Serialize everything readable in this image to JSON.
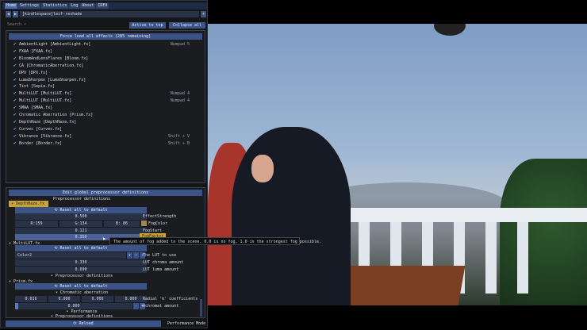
{
  "menu": [
    "Home",
    "Settings",
    "Statistics",
    "Log",
    "About",
    "IDE9"
  ],
  "preset": "[kindlespace]leif-reshade",
  "search": {
    "placeholder": "Search",
    "icon": "search-icon"
  },
  "buttons": {
    "active_to_top": "Active to top",
    "collapse_all": "Collapse all",
    "force_load": "Force load all effects (285 remaining)",
    "edit_global": "Edit global preprocessor definitions",
    "reload": "Reload",
    "performance_mode": "Performance Mode"
  },
  "effects": [
    {
      "name": "AmbientLight [AmbientLight.fx]",
      "key": "Numpad 5"
    },
    {
      "name": "FXAA [FXAA.fx]",
      "key": ""
    },
    {
      "name": "BloomAndLensFlares [Bloom.fx]",
      "key": ""
    },
    {
      "name": "CA [ChromaticAberration.fx]",
      "key": ""
    },
    {
      "name": "DPX [DPX.fx]",
      "key": ""
    },
    {
      "name": "LumaSharpen [LumaSharpen.fx]",
      "key": ""
    },
    {
      "name": "Tint [Sepia.fx]",
      "key": ""
    },
    {
      "name": "MultiLUT [MultiLUT.fx]",
      "key": "Numpad 4"
    },
    {
      "name": "MultiLUT [MultiLUT.fx]",
      "key": "Numpad 4"
    },
    {
      "name": "SMAA [SMAA.fx]",
      "key": ""
    },
    {
      "name": "Chromatic Aberration [Prism.fx]",
      "key": ""
    },
    {
      "name": "DepthHaze [DepthHaze.fx]",
      "key": ""
    },
    {
      "name": "Curves [Curves.fx]",
      "key": ""
    },
    {
      "name": "Vibrance [Vibrance.fx]",
      "key": "Shift + V"
    },
    {
      "name": "Border [Border.fx]",
      "key": "Shift + B"
    }
  ],
  "params": {
    "preproc": "Preprocessor definitions",
    "reset": "Reset all to default",
    "depthhaze": "DepthHaze.fx",
    "effect_strength": {
      "value": "0.500",
      "label": "EffectStrength"
    },
    "fog_color": {
      "r": "R:159",
      "g": "G:134",
      "b": "B: 86",
      "label": "FogColor",
      "swatch": "#9f8656"
    },
    "fog_start": {
      "value": "0.121",
      "label": "FogStart"
    },
    "fog_factor": {
      "value": "0.350",
      "label": "FogFactor"
    },
    "tooltip": "The amount of fog added to the scene. 0.0 is no fog, 1.0 is the strongest fog possible.",
    "multilut": "MultiLUT.fx",
    "lut_select": {
      "value": "Color2",
      "label": "The LUT to use"
    },
    "lut_chroma": {
      "value": "0.330",
      "label": "LUT chroma amount"
    },
    "lut_luma": {
      "value": "0.690",
      "label": "LUT luma amount"
    },
    "prism": "Prism.fx",
    "chromatic": "Chromatic aberration",
    "radial": {
      "values": [
        "0.016",
        "0.000",
        "0.000",
        "0.000"
      ],
      "label": "Radial 'k' coefficients"
    },
    "achromat": {
      "value": "0.000",
      "label": "Achromat amount"
    },
    "performance": "Performance"
  }
}
